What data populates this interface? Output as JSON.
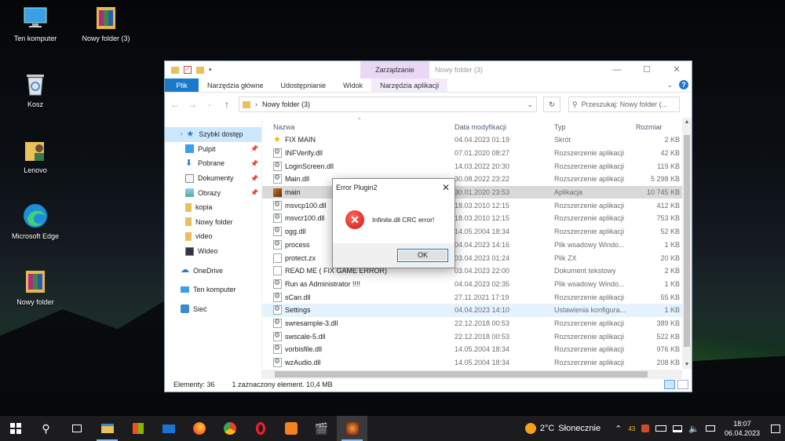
{
  "desktop": {
    "icons": [
      {
        "label": "Ten komputer"
      },
      {
        "label": "Nowy folder (3)"
      },
      {
        "label": "Kosz"
      },
      {
        "label": "Lenovo"
      },
      {
        "label": "Microsoft Edge"
      },
      {
        "label": "Nowy folder"
      }
    ]
  },
  "explorer": {
    "context_tab": "Zarządzanie",
    "title": "Nowy folder (3)",
    "ribbon_tabs": [
      "Plik",
      "Narzędzia główne",
      "Udostępnianie",
      "Widok",
      "Narzędzia aplikacji"
    ],
    "path": "Nowy folder (3)",
    "search_placeholder": "Przeszukaj: Nowy folder (...",
    "nav": [
      {
        "label": "Szybki dostęp",
        "pin": false
      },
      {
        "label": "Pulpit",
        "pin": true
      },
      {
        "label": "Pobrane",
        "pin": true
      },
      {
        "label": "Dokumenty",
        "pin": true
      },
      {
        "label": "Obrazy",
        "pin": true
      },
      {
        "label": "kopia",
        "pin": false
      },
      {
        "label": "Nowy folder",
        "pin": false
      },
      {
        "label": "video",
        "pin": false
      },
      {
        "label": "Wideo",
        "pin": false
      },
      {
        "label": "OneDrive",
        "pin": false
      },
      {
        "label": "Ten komputer",
        "pin": false
      },
      {
        "label": "Sieć",
        "pin": false
      }
    ],
    "columns": {
      "name": "Nazwa",
      "date": "Data modyfikacji",
      "type": "Typ",
      "size": "Rozmiar"
    },
    "files": [
      {
        "name": "FIX MAIN",
        "date": "04.04.2023 01:19",
        "type": "Skrót",
        "size": "2 KB"
      },
      {
        "name": "INFVerify.dll",
        "date": "07.01.2020 08:27",
        "type": "Rozszerzenie aplikacji",
        "size": "42 KB"
      },
      {
        "name": "LoginScreen.dll",
        "date": "14.03.2022 20:30",
        "type": "Rozszerzenie aplikacji",
        "size": "119 KB"
      },
      {
        "name": "Main.dll",
        "date": "30.08.2022 23:22",
        "type": "Rozszerzenie aplikacji",
        "size": "5 298 KB"
      },
      {
        "name": "main",
        "date": "30.01.2020 23:53",
        "type": "Aplikacja",
        "size": "10 745 KB"
      },
      {
        "name": "msvcp100.dll",
        "date": "18.03.2010 12:15",
        "type": "Rozszerzenie aplikacji",
        "size": "412 KB"
      },
      {
        "name": "msvcr100.dll",
        "date": "18.03.2010 12:15",
        "type": "Rozszerzenie aplikacji",
        "size": "753 KB"
      },
      {
        "name": "ogg.dll",
        "date": "14.05.2004 18:34",
        "type": "Rozszerzenie aplikacji",
        "size": "52 KB"
      },
      {
        "name": "process",
        "date": "04.04.2023 14:16",
        "type": "Plik wsadowy Windo...",
        "size": "1 KB"
      },
      {
        "name": "protect.zx",
        "date": "03.04.2023 01:24",
        "type": "Plik ZX",
        "size": "20 KB"
      },
      {
        "name": "READ ME ( FIX GAME ERROR)",
        "date": "03.04.2023 22:00",
        "type": "Dokument tekstowy",
        "size": "2 KB"
      },
      {
        "name": "Run as Administrator !!!!",
        "date": "04.04.2023 02:35",
        "type": "Plik wsadowy Windo...",
        "size": "1 KB"
      },
      {
        "name": "sCan.dll",
        "date": "27.11.2021 17:19",
        "type": "Rozszerzenie aplikacji",
        "size": "55 KB"
      },
      {
        "name": "Settings",
        "date": "04.04.2023 14:10",
        "type": "Ustawienia konfigura...",
        "size": "1 KB"
      },
      {
        "name": "swresample-3.dll",
        "date": "22.12.2018 00:53",
        "type": "Rozszerzenie aplikacji",
        "size": "389 KB"
      },
      {
        "name": "swscale-5.dll",
        "date": "22.12.2018 00:53",
        "type": "Rozszerzenie aplikacji",
        "size": "522 KB"
      },
      {
        "name": "vorbisfile.dll",
        "date": "14.05.2004 18:34",
        "type": "Rozszerzenie aplikacji",
        "size": "976 KB"
      },
      {
        "name": "wzAudio.dll",
        "date": "14.05.2004 18:34",
        "type": "Rozszerzenie aplikacji",
        "size": "208 KB"
      }
    ],
    "status_count": "Elementy: 36",
    "status_selected": "1 zaznaczony element. 10,4 MB"
  },
  "dialog": {
    "title": "Error Plugin2",
    "message": "Infinite.dll CRC error!",
    "ok_label": "OK"
  },
  "taskbar": {
    "weather_temp": "2°C",
    "weather_desc": "Słonecznie",
    "badge": "43",
    "time": "18:07",
    "date": "06.04.2023"
  }
}
